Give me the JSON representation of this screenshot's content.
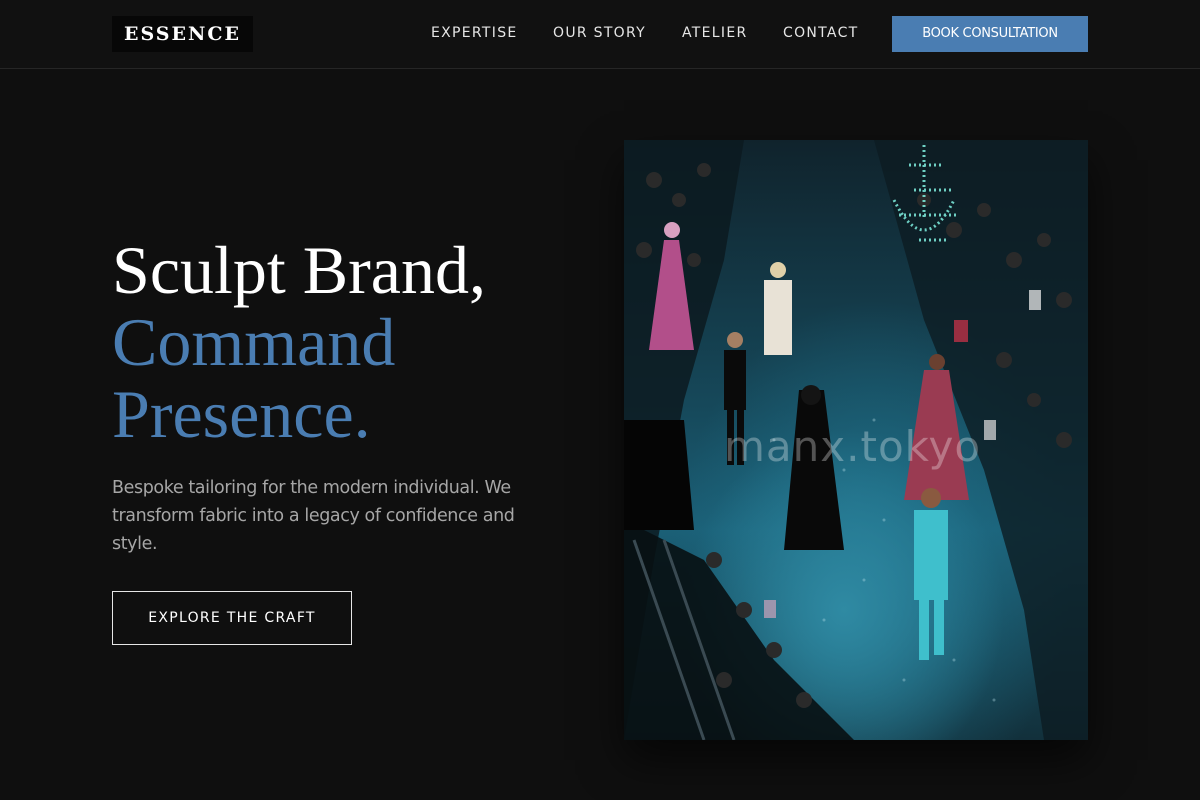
{
  "header": {
    "logo": "ESSENCE",
    "nav": [
      {
        "label": "EXPERTISE"
      },
      {
        "label": "OUR STORY"
      },
      {
        "label": "ATELIER"
      },
      {
        "label": "CONTACT"
      }
    ],
    "cta_label": "BOOK CONSULTATION"
  },
  "hero": {
    "title_line1": "Sculpt Brand,",
    "title_line2": "Command",
    "title_line3": "Presence.",
    "description": "Bespoke tailoring for the modern individual. We transform fabric into a legacy of confidence and style.",
    "button_label": "EXPLORE THE CRAFT",
    "image_watermark": "manx.tokyo"
  },
  "colors": {
    "accent": "#4a7db2",
    "background": "#0f0f0f",
    "text": "#ffffff",
    "muted_text": "#a6a6a6"
  }
}
